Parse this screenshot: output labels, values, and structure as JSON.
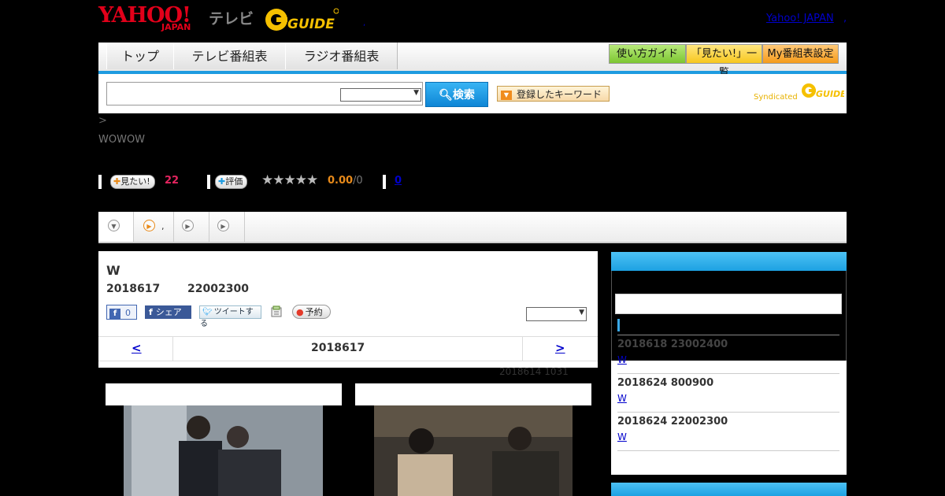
{
  "header": {
    "yahoo_logo": "YAHOO!",
    "japan_logo": "JAPAN",
    "tv_logo": "テレビ",
    "gguide_logo": "GUIDE",
    "yahoo_japan_link": "Yahoo! JAPAN",
    "dot": ",",
    "small_dot": ","
  },
  "nav": {
    "tabs": [
      "トップ",
      "テレビ番組表",
      "ラジオ番組表"
    ],
    "buttons": [
      "使い方ガイド",
      "「見たい!」一覧",
      "My番組表設定"
    ]
  },
  "search": {
    "button": "検索",
    "keyword_button": "登録したキーワード",
    "syndicated": "Syndicated"
  },
  "breadcrumb": ">",
  "channel": "WOWOW",
  "stats": {
    "want_label": "見たい!",
    "want_count": "22",
    "rate_label": "評価",
    "stars": "★★★★★",
    "rating": "0.00",
    "rating_total": "/0",
    "comment_count": "0"
  },
  "tabs": {
    "dot": ","
  },
  "program": {
    "title": "W",
    "date": "2018617",
    "time": "22002300",
    "fb_count": "0",
    "fb_share": "シェア",
    "tweet": "ツイートする",
    "reserve": "予約",
    "prev": "<",
    "next": ">",
    "current_date": "2018617",
    "updated": "2018614  1031"
  },
  "sidebar": {
    "items": [
      {
        "date": "2018618  23002400",
        "title": "W"
      },
      {
        "date": "2018624  800900",
        "title": "W"
      },
      {
        "date": "2018624  22002300",
        "title": "W"
      }
    ]
  },
  "colors": {
    "accent_blue": "#1e9be0",
    "yahoo_red": "#e2001a",
    "gguide_yellow": "#f5c000",
    "want_pink": "#e4245f",
    "rating_orange": "#e88a1a"
  }
}
